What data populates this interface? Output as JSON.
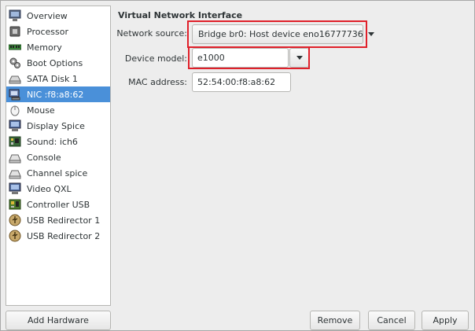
{
  "sidebar": {
    "items": [
      {
        "label": "Overview",
        "icon": "monitor-icon"
      },
      {
        "label": "Processor",
        "icon": "cpu-chip-icon"
      },
      {
        "label": "Memory",
        "icon": "memory-module-icon"
      },
      {
        "label": "Boot Options",
        "icon": "gears-icon"
      },
      {
        "label": "SATA Disk 1",
        "icon": "disk-drive-icon"
      },
      {
        "label": "NIC :f8:a8:62",
        "icon": "network-card-icon",
        "selected": true
      },
      {
        "label": "Mouse",
        "icon": "mouse-icon"
      },
      {
        "label": "Display Spice",
        "icon": "display-icon"
      },
      {
        "label": "Sound: ich6",
        "icon": "sound-card-icon"
      },
      {
        "label": "Console",
        "icon": "serial-port-icon"
      },
      {
        "label": "Channel spice",
        "icon": "serial-port-icon"
      },
      {
        "label": "Video QXL",
        "icon": "video-card-icon"
      },
      {
        "label": "Controller USB",
        "icon": "controller-icon"
      },
      {
        "label": "USB Redirector 1",
        "icon": "usb-redirector-icon"
      },
      {
        "label": "USB Redirector 2",
        "icon": "usb-redirector-icon"
      }
    ],
    "add_hardware_label": "Add Hardware"
  },
  "main": {
    "section_title": "Virtual Network Interface",
    "network_source": {
      "label": "Network source:",
      "value": "Bridge br0: Host device eno16777736"
    },
    "device_model": {
      "label": "Device model:",
      "value": "e1000"
    },
    "mac_address": {
      "label": "MAC address:",
      "value": "52:54:00:f8:a8:62"
    }
  },
  "buttons": {
    "remove": "Remove",
    "cancel": "Cancel",
    "apply": "Apply"
  },
  "colors": {
    "selection": "#4a90d9",
    "highlight": "#e0202a"
  }
}
